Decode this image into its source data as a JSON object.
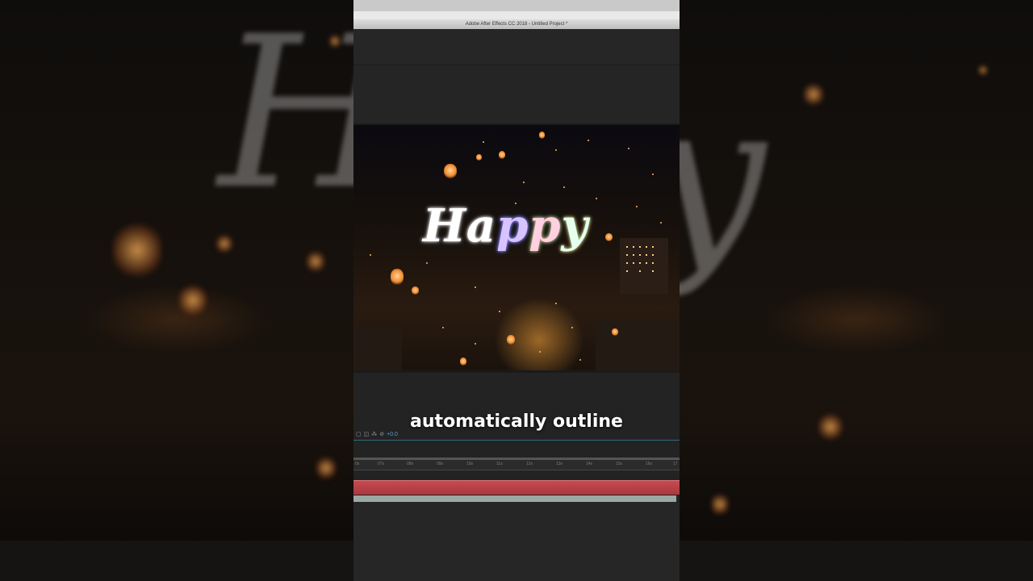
{
  "window": {
    "title": "Adobe After Effects CC 2018 - Untitled Project *"
  },
  "composition": {
    "text_layer": {
      "letters": [
        "H",
        "a",
        "p",
        "p",
        "y"
      ]
    }
  },
  "caption": {
    "text": "automatically outline"
  },
  "timeline": {
    "toolbar_icons": [
      "comment-icon",
      "solo-icon",
      "motion-blur-icon",
      "graph-icon",
      "draft-3d-icon"
    ],
    "frame_readout": "+0.0",
    "ruler_ticks": [
      "0s",
      "07s",
      "08s",
      "09s",
      "10s",
      "11s",
      "12s",
      "13s",
      "14s",
      "15s",
      "16s",
      "17"
    ]
  },
  "colors": {
    "panel": "#232323",
    "track_red": "#c74b50",
    "accent_blue": "#5a9bd6"
  }
}
